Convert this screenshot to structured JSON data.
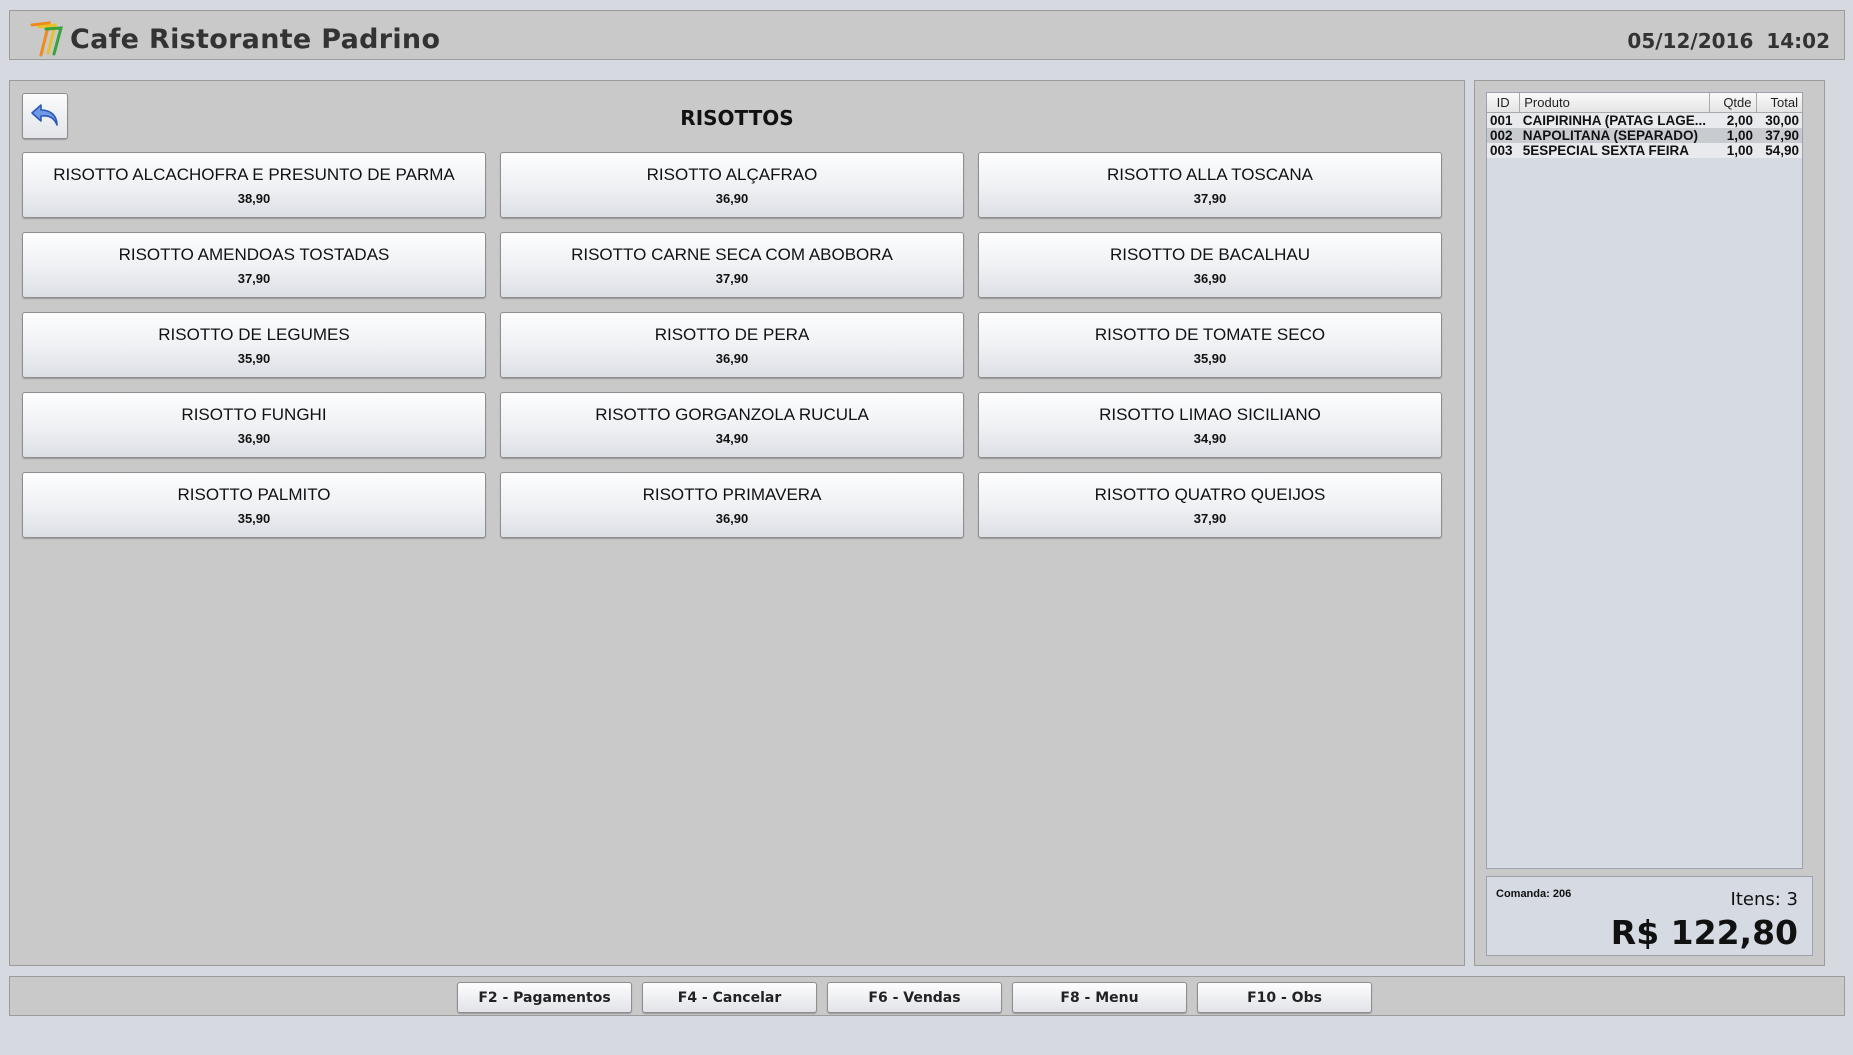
{
  "header": {
    "title": "Cafe Ristorante Padrino",
    "date": "05/12/2016",
    "time": "14:02"
  },
  "main": {
    "category_title": "RISOTTOS",
    "back_icon": "back-arrow-icon",
    "products": [
      {
        "name": "RISOTTO ALCACHOFRA E PRESUNTO DE PARMA",
        "price": "38,90"
      },
      {
        "name": "RISOTTO ALÇAFRAO",
        "price": "36,90"
      },
      {
        "name": "RISOTTO ALLA TOSCANA",
        "price": "37,90"
      },
      {
        "name": "RISOTTO AMENDOAS TOSTADAS",
        "price": "37,90"
      },
      {
        "name": "RISOTTO CARNE SECA COM ABOBORA",
        "price": "37,90"
      },
      {
        "name": "RISOTTO DE BACALHAU",
        "price": "36,90"
      },
      {
        "name": "RISOTTO DE LEGUMES",
        "price": "35,90"
      },
      {
        "name": "RISOTTO DE PERA",
        "price": "36,90"
      },
      {
        "name": "RISOTTO DE TOMATE SECO",
        "price": "35,90"
      },
      {
        "name": "RISOTTO FUNGHI",
        "price": "36,90"
      },
      {
        "name": "RISOTTO GORGANZOLA RUCULA",
        "price": "34,90"
      },
      {
        "name": "RISOTTO LIMAO SICILIANO",
        "price": "34,90"
      },
      {
        "name": "RISOTTO PALMITO",
        "price": "35,90"
      },
      {
        "name": "RISOTTO PRIMAVERA",
        "price": "36,90"
      },
      {
        "name": "RISOTTO QUATRO QUEIJOS",
        "price": "37,90"
      }
    ]
  },
  "order": {
    "columns": {
      "id": "ID",
      "product": "Produto",
      "qty": "Qtde",
      "total": "Total"
    },
    "rows": [
      {
        "id": "001",
        "product": "CAIPIRINHA (PATAG LAGE...",
        "qty": "2,00",
        "total": "30,00"
      },
      {
        "id": "002",
        "product": "NAPOLITANA (SEPARADO)",
        "qty": "1,00",
        "total": "37,90"
      },
      {
        "id": "003",
        "product": "5ESPECIAL SEXTA FEIRA",
        "qty": "1,00",
        "total": "54,90"
      }
    ],
    "comanda": "Comanda: 206",
    "items_count": "Itens: 3",
    "grand_total": "R$ 122,80"
  },
  "footer": {
    "buttons": [
      "F2 - Pagamentos",
      "F4 - Cancelar",
      "F6 - Vendas",
      "F8 - Menu",
      "F10 - Obs"
    ]
  },
  "colors": {
    "panel_bg": "#c9c9c9",
    "page_bg": "#d6d9e0",
    "list_bg": "#d6dae2",
    "logo_orange": "#f08a1c",
    "logo_green": "#3aa33a",
    "back_arrow_blue": "#3b6fd4"
  }
}
